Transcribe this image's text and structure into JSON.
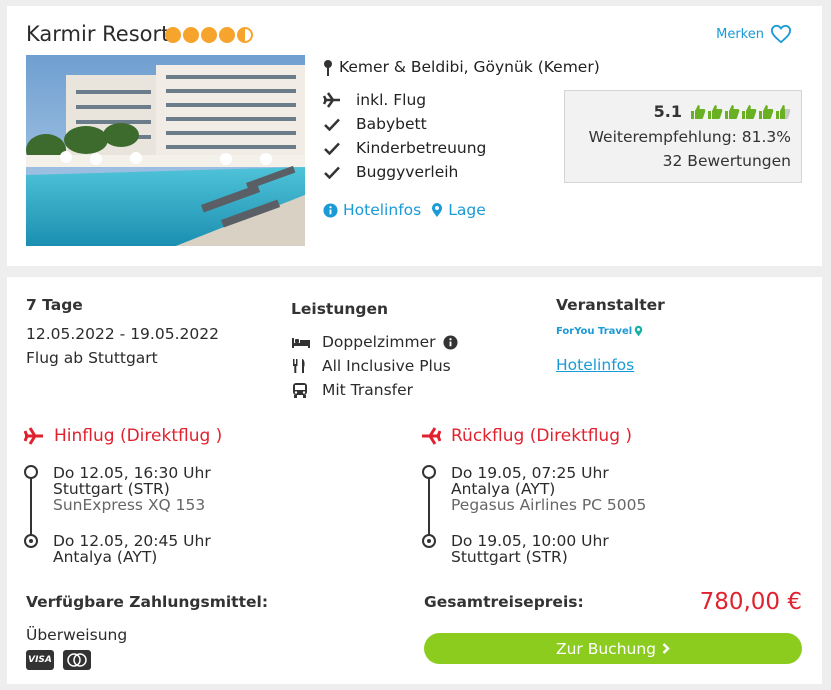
{
  "hotel": {
    "name": "Karmir Resort",
    "stars": 4.5,
    "merken_label": "Merken",
    "location": "Kemer & Beldibi, Göynük (Kemer)",
    "features": [
      "inkl. Flug",
      "Babybett",
      "Kinderbetreuung",
      "Buggyverleih"
    ],
    "links": {
      "hotelinfos": "Hotelinfos",
      "lage": "Lage"
    },
    "rating": {
      "score": "5.1",
      "thumbs": 5.5,
      "recommendation": "Weiterempfehlung: 81.3%",
      "reviews": "32 Bewertungen"
    }
  },
  "offer": {
    "duration": "7 Tage",
    "dates": "12.05.2022 - 19.05.2022",
    "departure": "Flug ab Stuttgart",
    "services_heading": "Leistungen",
    "services": [
      "Doppelzimmer",
      "All Inclusive Plus",
      "Mit Transfer"
    ],
    "operator_heading": "Veranstalter",
    "operator_logo_text": "ForYou Travel",
    "operator_link": "Hotelinfos"
  },
  "outbound": {
    "title": "Hinflug (Direktflug )",
    "dep_time": "Do 12.05, 16:30 Uhr",
    "dep_airport": "Stuttgart (STR)",
    "airline": "SunExpress XQ 153",
    "arr_time": "Do 12.05, 20:45 Uhr",
    "arr_airport": "Antalya (AYT)"
  },
  "return": {
    "title": "Rückflug (Direktflug )",
    "dep_time": "Do 19.05, 07:25 Uhr",
    "dep_airport": "Antalya (AYT)",
    "airline": "Pegasus Airlines PC 5005",
    "arr_time": "Do 19.05, 10:00 Uhr",
    "arr_airport": "Stuttgart (STR)"
  },
  "payment": {
    "heading": "Verfügbare Zahlungsmittel:",
    "method": "Überweisung",
    "cards": [
      "VISA",
      "Mastercard"
    ]
  },
  "total": {
    "label": "Gesamtreisepreis:",
    "price": "780,00 €",
    "button": "Zur Buchung"
  },
  "colors": {
    "accent": "#1a9ad6",
    "price": "#e0222e",
    "button": "#8ccc1e",
    "stars": "#f7a42c",
    "thumbs": "#6ab023"
  }
}
